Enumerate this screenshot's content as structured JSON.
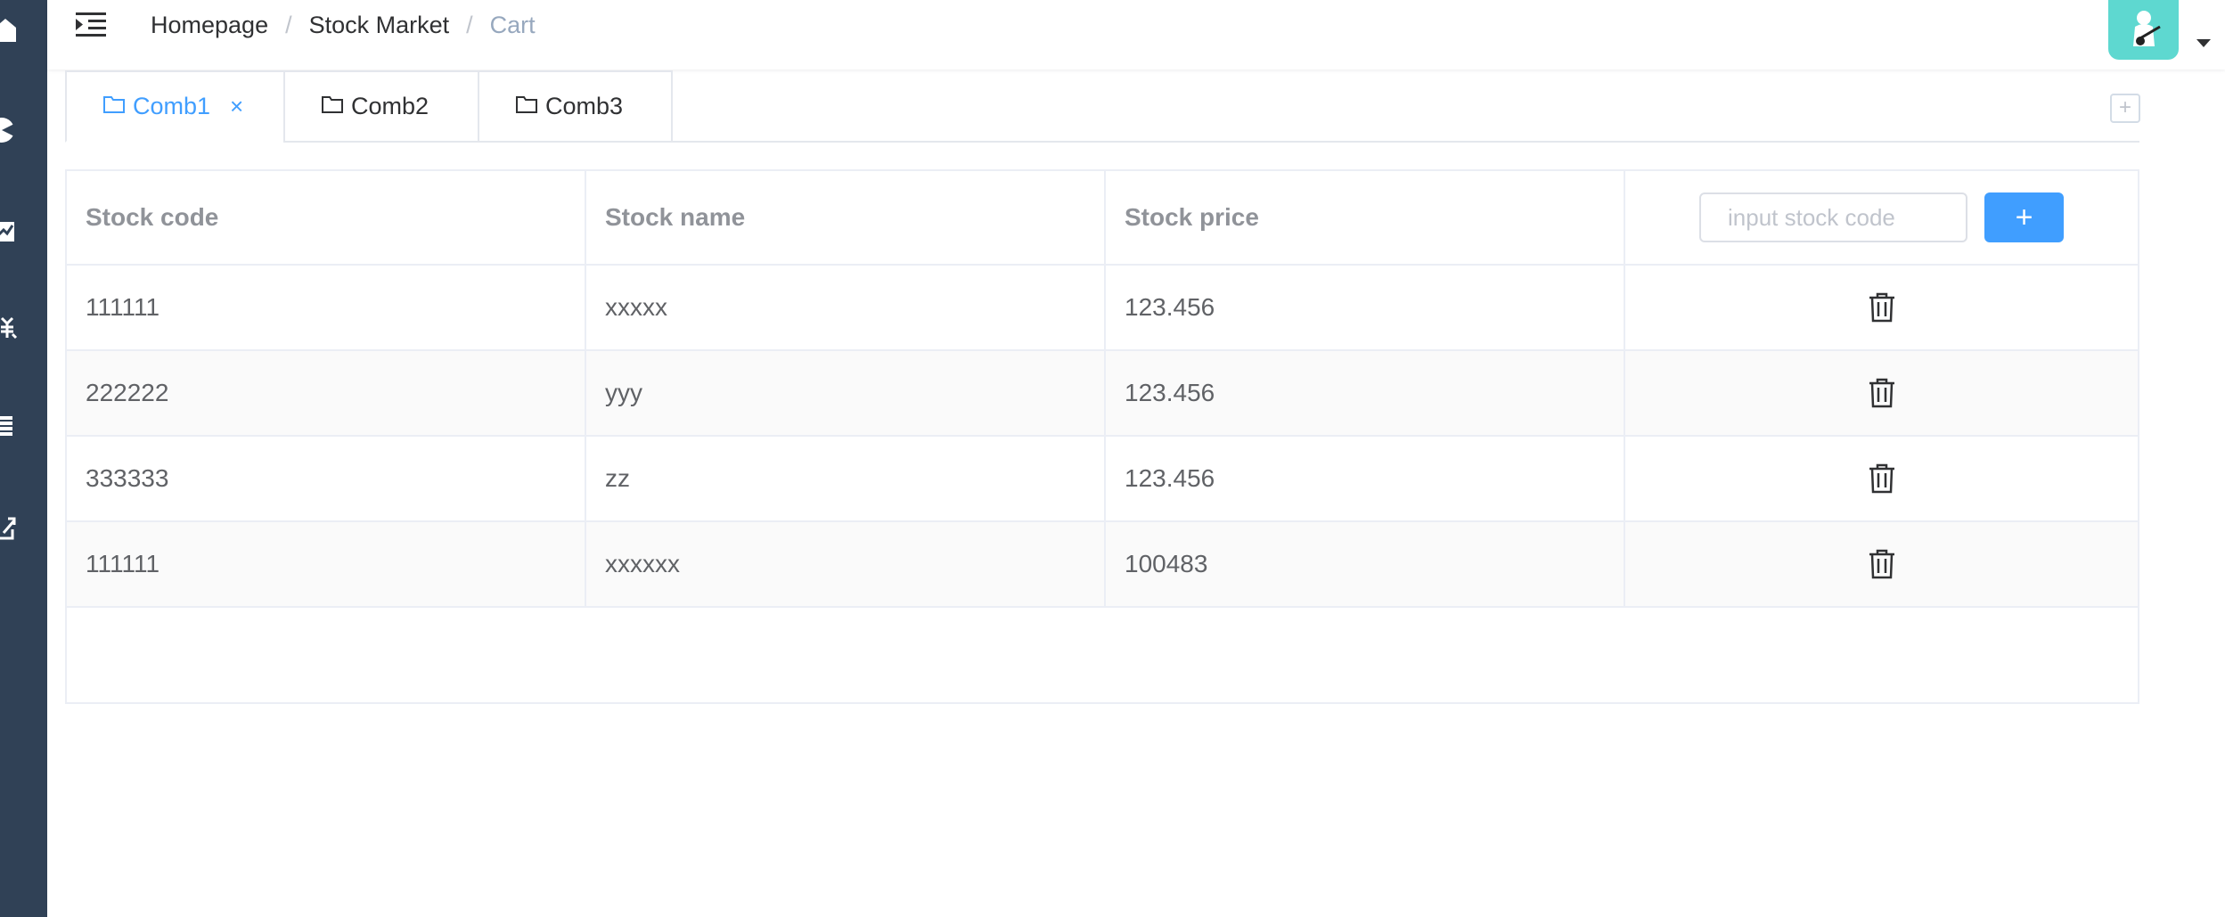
{
  "breadcrumb": {
    "items": [
      "Homepage",
      "Stock Market",
      "Cart"
    ],
    "separator": "/"
  },
  "tabs": [
    {
      "label": "Comb1",
      "active": true,
      "close": "×"
    },
    {
      "label": "Comb2",
      "active": false
    },
    {
      "label": "Comb3",
      "active": false
    }
  ],
  "tab_add_label": "+",
  "table": {
    "headers": [
      "Stock code",
      "Stock name",
      "Stock price"
    ],
    "input_placeholder": "input stock code",
    "add_button": "+",
    "rows": [
      {
        "code": "111111",
        "name": "xxxxx",
        "price": "123.456"
      },
      {
        "code": "222222",
        "name": "yyy",
        "price": "123.456"
      },
      {
        "code": "333333",
        "name": "zz",
        "price": "123.456"
      },
      {
        "code": "111111",
        "name": "xxxxxx",
        "price": "100483"
      }
    ]
  },
  "sidebar": {
    "icons": [
      "home-icon",
      "chart-pie-icon",
      "chart-line-icon",
      "money-icon",
      "list-icon",
      "external-link-icon"
    ]
  },
  "colors": {
    "sidebar": "#304156",
    "accent": "#409eff",
    "avatar": "#5ed8d0"
  }
}
